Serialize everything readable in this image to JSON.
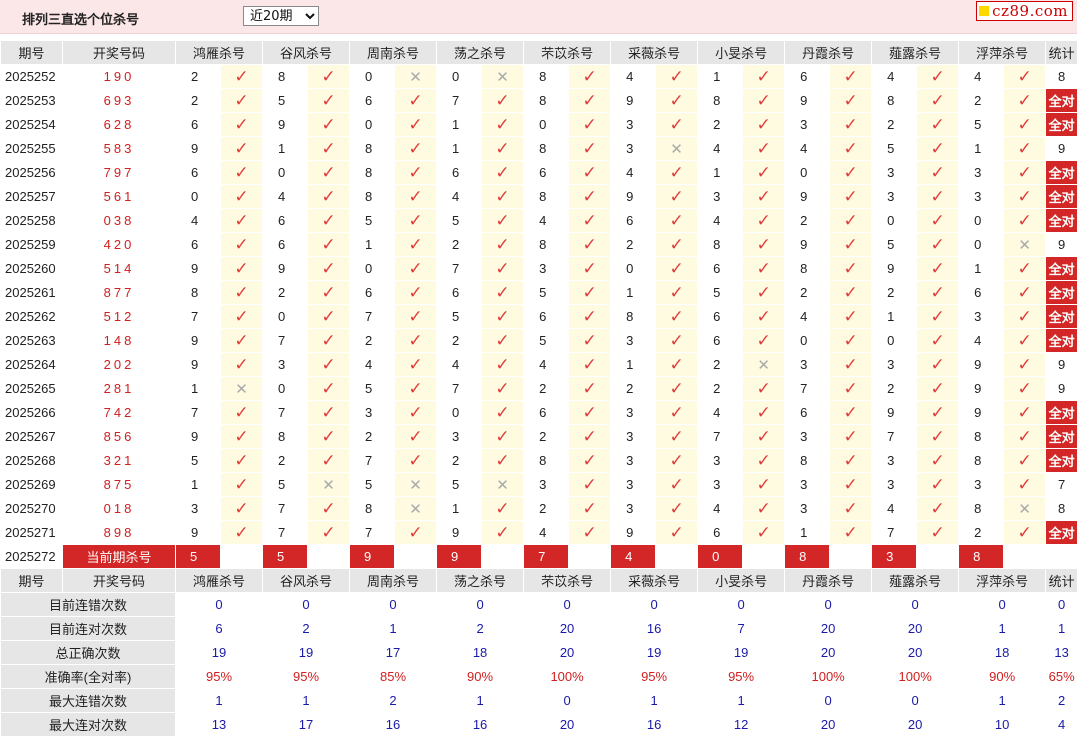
{
  "header": {
    "title": "排列三直选个位杀号",
    "period_select": "近20期",
    "logo_text": "cz89.com"
  },
  "columns": {
    "period": "期号",
    "draw": "开奖号码",
    "experts": [
      "鸿雁杀号",
      "谷风杀号",
      "周南杀号",
      "荡之杀号",
      "芣苡杀号",
      "采薇杀号",
      "小旻杀号",
      "丹霞杀号",
      "薤露杀号",
      "浮萍杀号"
    ],
    "stat": "统计"
  },
  "rows": [
    {
      "period": "2025252",
      "draw": "190",
      "kills": [
        2,
        8,
        0,
        0,
        8,
        4,
        1,
        6,
        4,
        4
      ],
      "ok": [
        1,
        1,
        0,
        0,
        1,
        1,
        1,
        1,
        1,
        1
      ],
      "stat": "8"
    },
    {
      "period": "2025253",
      "draw": "693",
      "kills": [
        2,
        5,
        6,
        7,
        8,
        9,
        8,
        9,
        8,
        2
      ],
      "ok": [
        1,
        1,
        1,
        1,
        1,
        1,
        1,
        1,
        1,
        1
      ],
      "stat": "全对"
    },
    {
      "period": "2025254",
      "draw": "628",
      "kills": [
        6,
        9,
        0,
        1,
        0,
        3,
        2,
        3,
        2,
        5
      ],
      "ok": [
        1,
        1,
        1,
        1,
        1,
        1,
        1,
        1,
        1,
        1
      ],
      "stat": "全对"
    },
    {
      "period": "2025255",
      "draw": "583",
      "kills": [
        9,
        1,
        8,
        1,
        8,
        3,
        4,
        4,
        5,
        1
      ],
      "ok": [
        1,
        1,
        1,
        1,
        1,
        0,
        1,
        1,
        1,
        1
      ],
      "stat": "9"
    },
    {
      "period": "2025256",
      "draw": "797",
      "kills": [
        6,
        0,
        8,
        6,
        6,
        4,
        1,
        0,
        3,
        3
      ],
      "ok": [
        1,
        1,
        1,
        1,
        1,
        1,
        1,
        1,
        1,
        1
      ],
      "stat": "全对"
    },
    {
      "period": "2025257",
      "draw": "561",
      "kills": [
        0,
        4,
        8,
        4,
        8,
        9,
        3,
        9,
        3,
        3
      ],
      "ok": [
        1,
        1,
        1,
        1,
        1,
        1,
        1,
        1,
        1,
        1
      ],
      "stat": "全对"
    },
    {
      "period": "2025258",
      "draw": "038",
      "kills": [
        4,
        6,
        5,
        5,
        4,
        6,
        4,
        2,
        0,
        0
      ],
      "ok": [
        1,
        1,
        1,
        1,
        1,
        1,
        1,
        1,
        1,
        1
      ],
      "stat": "全对"
    },
    {
      "period": "2025259",
      "draw": "420",
      "kills": [
        6,
        6,
        1,
        2,
        8,
        2,
        8,
        9,
        5,
        0
      ],
      "ok": [
        1,
        1,
        1,
        1,
        1,
        1,
        1,
        1,
        1,
        0
      ],
      "stat": "9"
    },
    {
      "period": "2025260",
      "draw": "514",
      "kills": [
        9,
        9,
        0,
        7,
        3,
        0,
        6,
        8,
        9,
        1
      ],
      "ok": [
        1,
        1,
        1,
        1,
        1,
        1,
        1,
        1,
        1,
        1
      ],
      "stat": "全对"
    },
    {
      "period": "2025261",
      "draw": "877",
      "kills": [
        8,
        2,
        6,
        6,
        5,
        1,
        5,
        2,
        2,
        6
      ],
      "ok": [
        1,
        1,
        1,
        1,
        1,
        1,
        1,
        1,
        1,
        1
      ],
      "stat": "全对"
    },
    {
      "period": "2025262",
      "draw": "512",
      "kills": [
        7,
        0,
        7,
        5,
        6,
        8,
        6,
        4,
        1,
        3
      ],
      "ok": [
        1,
        1,
        1,
        1,
        1,
        1,
        1,
        1,
        1,
        1
      ],
      "stat": "全对"
    },
    {
      "period": "2025263",
      "draw": "148",
      "kills": [
        9,
        7,
        2,
        2,
        5,
        3,
        6,
        0,
        0,
        4
      ],
      "ok": [
        1,
        1,
        1,
        1,
        1,
        1,
        1,
        1,
        1,
        1
      ],
      "stat": "全对"
    },
    {
      "period": "2025264",
      "draw": "202",
      "kills": [
        9,
        3,
        4,
        4,
        4,
        1,
        2,
        3,
        3,
        9
      ],
      "ok": [
        1,
        1,
        1,
        1,
        1,
        1,
        0,
        1,
        1,
        1
      ],
      "stat": "9"
    },
    {
      "period": "2025265",
      "draw": "281",
      "kills": [
        1,
        0,
        5,
        7,
        2,
        2,
        2,
        7,
        2,
        9
      ],
      "ok": [
        0,
        1,
        1,
        1,
        1,
        1,
        1,
        1,
        1,
        1
      ],
      "stat": "9"
    },
    {
      "period": "2025266",
      "draw": "742",
      "kills": [
        7,
        7,
        3,
        0,
        6,
        3,
        4,
        6,
        9,
        9
      ],
      "ok": [
        1,
        1,
        1,
        1,
        1,
        1,
        1,
        1,
        1,
        1
      ],
      "stat": "全对"
    },
    {
      "period": "2025267",
      "draw": "856",
      "kills": [
        9,
        8,
        2,
        3,
        2,
        3,
        7,
        3,
        7,
        8
      ],
      "ok": [
        1,
        1,
        1,
        1,
        1,
        1,
        1,
        1,
        1,
        1
      ],
      "stat": "全对"
    },
    {
      "period": "2025268",
      "draw": "321",
      "kills": [
        5,
        2,
        7,
        2,
        8,
        3,
        3,
        8,
        3,
        8
      ],
      "ok": [
        1,
        1,
        1,
        1,
        1,
        1,
        1,
        1,
        1,
        1
      ],
      "stat": "全对"
    },
    {
      "period": "2025269",
      "draw": "875",
      "kills": [
        1,
        5,
        5,
        5,
        3,
        3,
        3,
        3,
        3,
        3
      ],
      "ok": [
        1,
        0,
        0,
        0,
        1,
        1,
        1,
        1,
        1,
        1
      ],
      "stat": "7"
    },
    {
      "period": "2025270",
      "draw": "018",
      "kills": [
        3,
        7,
        8,
        1,
        2,
        3,
        4,
        3,
        4,
        8
      ],
      "ok": [
        1,
        1,
        0,
        1,
        1,
        1,
        1,
        1,
        1,
        0
      ],
      "stat": "8"
    },
    {
      "period": "2025271",
      "draw": "898",
      "kills": [
        9,
        7,
        7,
        9,
        4,
        9,
        6,
        1,
        7,
        2
      ],
      "ok": [
        1,
        1,
        1,
        1,
        1,
        1,
        1,
        1,
        1,
        1
      ],
      "stat": "全对"
    }
  ],
  "current": {
    "period": "2025272",
    "label": "当前期杀号",
    "kills": [
      "5",
      "5",
      "9",
      "9",
      "7",
      "4",
      "0",
      "8",
      "3",
      "8"
    ]
  },
  "stats": [
    {
      "label": "目前连错次数",
      "values": [
        "0",
        "0",
        "0",
        "0",
        "0",
        "0",
        "0",
        "0",
        "0",
        "0",
        "0"
      ]
    },
    {
      "label": "目前连对次数",
      "values": [
        "6",
        "2",
        "1",
        "2",
        "20",
        "16",
        "7",
        "20",
        "20",
        "1",
        "1"
      ]
    },
    {
      "label": "总正确次数",
      "values": [
        "19",
        "19",
        "17",
        "18",
        "20",
        "19",
        "19",
        "20",
        "20",
        "18",
        "13"
      ]
    },
    {
      "label": "准确率(全对率)",
      "values": [
        "95%",
        "95%",
        "85%",
        "90%",
        "100%",
        "95%",
        "95%",
        "100%",
        "100%",
        "90%",
        "65%"
      ],
      "pct": true
    },
    {
      "label": "最大连错次数",
      "values": [
        "1",
        "1",
        "2",
        "1",
        "0",
        "1",
        "1",
        "0",
        "0",
        "1",
        "2"
      ]
    },
    {
      "label": "最大连对次数",
      "values": [
        "13",
        "17",
        "16",
        "16",
        "20",
        "16",
        "12",
        "20",
        "20",
        "10",
        "4"
      ]
    }
  ],
  "symbols": {
    "correct": "✓",
    "wrong": "✕"
  }
}
